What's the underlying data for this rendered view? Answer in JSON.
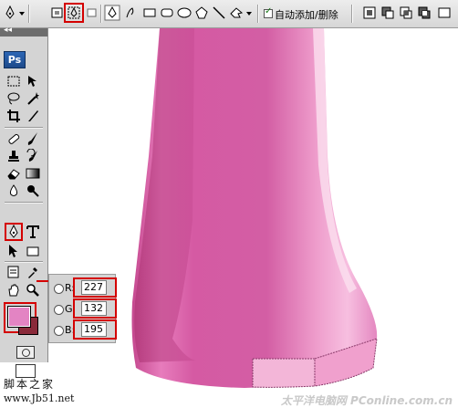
{
  "options_bar": {
    "auto_add_delete_label": "自动添加/删除",
    "auto_add_delete_checked": true,
    "highlighted_tool": "paths-mode-icon"
  },
  "toolbox": {
    "logo": "Ps",
    "collapse_label": "◂◂",
    "highlighted_tool": "pen-tool-icon"
  },
  "colors": {
    "foreground": "#e384c3",
    "background": "#8a2a3a",
    "accent_red": "#d40000",
    "bottle_pink": "#d95aa6"
  },
  "color_picker": {
    "r_label": "R:",
    "r_value": "227",
    "g_label": "G:",
    "g_value": "132",
    "b_label": "B:",
    "b_value": "195"
  },
  "watermarks": {
    "left_text": "脚本之家",
    "left_url": "www.Jb51.net",
    "right_text": "太平洋电脑网 PConline.com.cn"
  }
}
